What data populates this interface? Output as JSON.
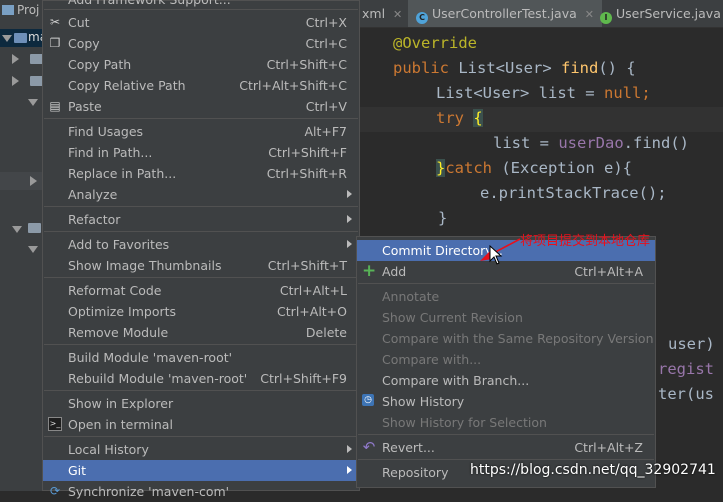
{
  "project_panel": {
    "tab_label": "Proj",
    "row_text": "ma"
  },
  "tabs": [
    {
      "label": "xml",
      "icon": "none"
    },
    {
      "label": "UserControllerTest.java",
      "icon": "class-icon"
    },
    {
      "label": "UserService.java",
      "icon": "interface-icon"
    }
  ],
  "code": {
    "annotation": "@Override",
    "sig_kw": "public",
    "sig_type": " List<User> ",
    "sig_fn": "find",
    "sig_rest": "() {",
    "line2_a": "List<User> list = ",
    "line2_b": "null",
    "line2_c": ";",
    "try_kw": "try",
    "try_brace": "{",
    "line4_a": "list = ",
    "line4_b": "userDao",
    "line4_c": ".find()",
    "catch_brace": "}",
    "catch_kw": "catch",
    "catch_rest": " (Exception e){",
    "line6": "e.printStackTrace();",
    "line7": "}",
    "frag1": "user)",
    "frag2": "regist",
    "frag3": "ter(us"
  },
  "context_menu": {
    "top_partial": "Add Framework Support...",
    "items": [
      {
        "label": "Cut",
        "shortcut": "Ctrl+X",
        "icon": "scissors-icon"
      },
      {
        "label": "Copy",
        "shortcut": "Ctrl+C",
        "icon": "copy-icon"
      },
      {
        "label": "Copy Path",
        "shortcut": "Ctrl+Shift+C"
      },
      {
        "label": "Copy Relative Path",
        "shortcut": "Ctrl+Alt+Shift+C"
      },
      {
        "label": "Paste",
        "shortcut": "Ctrl+V",
        "icon": "paste-icon"
      },
      {
        "label": "Find Usages",
        "shortcut": "Alt+F7"
      },
      {
        "label": "Find in Path...",
        "shortcut": "Ctrl+Shift+F"
      },
      {
        "label": "Replace in Path...",
        "shortcut": "Ctrl+Shift+R"
      },
      {
        "label": "Analyze",
        "shortcut": ""
      },
      {
        "label": "Refactor",
        "shortcut": ""
      },
      {
        "label": "Add to Favorites",
        "shortcut": ""
      },
      {
        "label": "Show Image Thumbnails",
        "shortcut": "Ctrl+Shift+T"
      },
      {
        "label": "Reformat Code",
        "shortcut": "Ctrl+Alt+L"
      },
      {
        "label": "Optimize Imports",
        "shortcut": "Ctrl+Alt+O"
      },
      {
        "label": "Remove Module",
        "shortcut": "Delete"
      },
      {
        "label": "Build Module 'maven-root'",
        "shortcut": ""
      },
      {
        "label": "Rebuild Module 'maven-root'",
        "shortcut": "Ctrl+Shift+F9"
      },
      {
        "label": "Show in Explorer",
        "shortcut": ""
      },
      {
        "label": "Open in terminal",
        "shortcut": "",
        "icon": "terminal-icon"
      },
      {
        "label": "Local History",
        "shortcut": ""
      },
      {
        "label": "Git",
        "shortcut": ""
      },
      {
        "label": "Synchronize 'maven-com'",
        "shortcut": ""
      }
    ]
  },
  "git_submenu": {
    "items": [
      {
        "label": "Commit Directory...",
        "shortcut": ""
      },
      {
        "label": "Add",
        "shortcut": "Ctrl+Alt+A",
        "icon": "add-icon"
      },
      {
        "label": "Annotate",
        "shortcut": ""
      },
      {
        "label": "Show Current Revision",
        "shortcut": ""
      },
      {
        "label": "Compare with the Same Repository Version",
        "shortcut": ""
      },
      {
        "label": "Compare with...",
        "shortcut": ""
      },
      {
        "label": "Compare with Branch...",
        "shortcut": ""
      },
      {
        "label": "Show History",
        "shortcut": "",
        "icon": "history-icon"
      },
      {
        "label": "Show History for Selection",
        "shortcut": ""
      },
      {
        "label": "Revert...",
        "shortcut": "Ctrl+Alt+Z",
        "icon": "revert-icon"
      },
      {
        "label": "Repository",
        "shortcut": ""
      }
    ]
  },
  "annotation_text": "将项目提交到本地仓库",
  "watermark": "https://blog.csdn.net/qq_32902741",
  "colors": {
    "menu_bg": "#3c3f41",
    "highlight": "#4b6eaf",
    "annotation_red": "#e8101b"
  }
}
